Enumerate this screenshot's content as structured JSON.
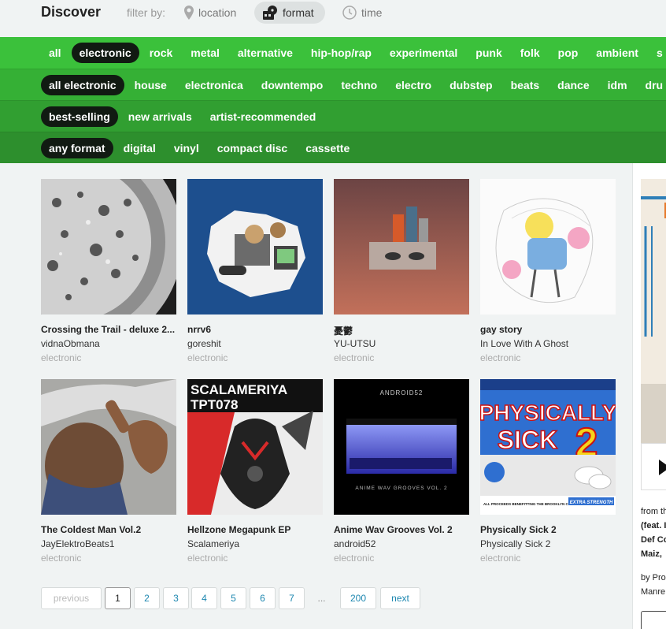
{
  "header": {
    "title": "Discover",
    "filter_label": "filter by:",
    "filters": [
      {
        "label": "location",
        "icon": "pin-icon",
        "active": false
      },
      {
        "label": "format",
        "icon": "vinyl-icon",
        "active": true
      },
      {
        "label": "time",
        "icon": "clock-icon",
        "active": false
      }
    ]
  },
  "genres": [
    "all",
    "electronic",
    "rock",
    "metal",
    "alternative",
    "hip-hop/rap",
    "experimental",
    "punk",
    "folk",
    "pop",
    "ambient",
    "s"
  ],
  "subgenres": [
    "all electronic",
    "house",
    "electronica",
    "downtempo",
    "techno",
    "electro",
    "dubstep",
    "beats",
    "dance",
    "idm",
    "dru"
  ],
  "sorts": [
    "best-selling",
    "new arrivals",
    "artist-recommended"
  ],
  "formats": [
    "any format",
    "digital",
    "vinyl",
    "compact disc",
    "cassette"
  ],
  "albums": [
    {
      "title": "Crossing the Trail - deluxe 2...",
      "artist": "vidnaObmana",
      "genre": "electronic"
    },
    {
      "title": "nrrv6",
      "artist": "goreshit",
      "genre": "electronic"
    },
    {
      "title": "憂鬱",
      "artist": "YU-UTSU",
      "genre": "electronic"
    },
    {
      "title": "gay story",
      "artist": "In Love With A Ghost",
      "genre": "electronic"
    },
    {
      "title": "The Coldest Man Vol.2",
      "artist": "JayElektroBeats1",
      "genre": "electronic"
    },
    {
      "title": "Hellzone Megapunk EP",
      "artist": "Scalameriya",
      "genre": "electronic"
    },
    {
      "title": "Anime Wav Grooves Vol. 2",
      "artist": "android52",
      "genre": "electronic"
    },
    {
      "title": "Physically Sick 2",
      "artist": "Physically Sick 2",
      "genre": "electronic"
    }
  ],
  "cover_text": {
    "scalameriya": "SCALAMERIYA",
    "scalameriya_code": "TPT078",
    "android_top": "ANDROID52",
    "android_bottom": "ANIME WAV GROOVES VOL. 2",
    "sick_line1": "PHYSICALLY",
    "sick_line2": "SICK",
    "sick_num": "2",
    "sick_footer": "ALL PROCEEDS BENEFITTING THE BROOKLYN COMMUNITY BAIL FUND",
    "sick_badge": "EXTRA STRENGTH"
  },
  "pagination": {
    "previous": "previous",
    "pages": [
      "1",
      "2",
      "3",
      "4",
      "5",
      "6",
      "7"
    ],
    "ellipsis": "...",
    "last": "200",
    "next": "next",
    "current": "1"
  },
  "side_panel": {
    "line1": "from th",
    "line2": "(feat. I",
    "line3": "Def Co",
    "line4": "Maiz, ",
    "line5": "by Pro",
    "line6": "Manre"
  },
  "colors": {
    "genre_bar": "#3bc13b",
    "link": "#1d87b0",
    "selected_pill": "#111a12"
  }
}
